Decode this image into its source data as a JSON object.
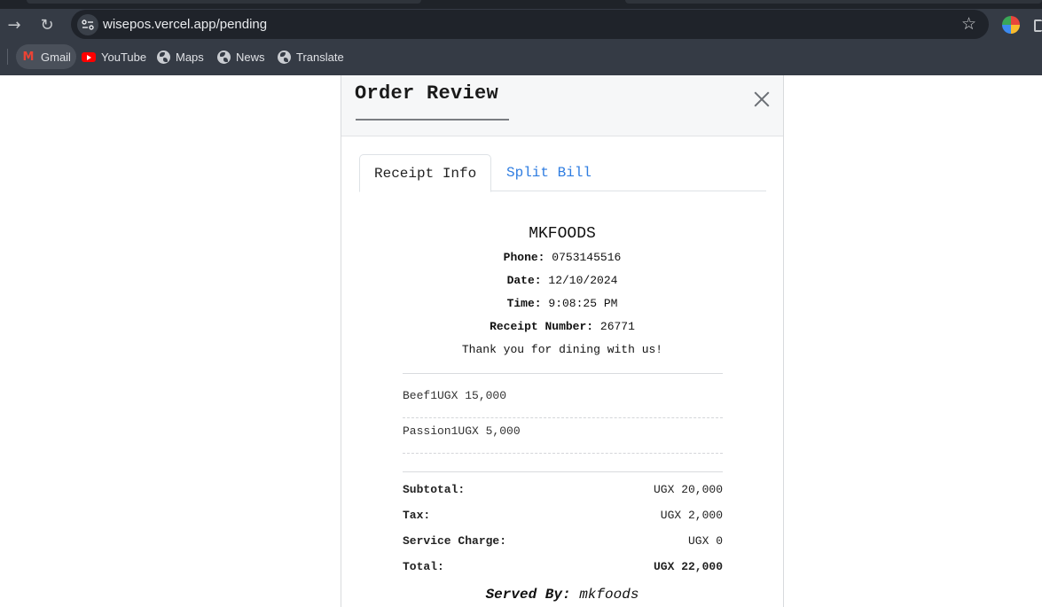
{
  "browser": {
    "url": "wisepos.vercel.app/pending",
    "bookmarks": [
      {
        "label": "Gmail",
        "icon": "gmail-icon"
      },
      {
        "label": "YouTube",
        "icon": "youtube-icon"
      },
      {
        "label": "Maps",
        "icon": "globe-icon"
      },
      {
        "label": "News",
        "icon": "globe-icon"
      },
      {
        "label": "Translate",
        "icon": "globe-icon"
      }
    ]
  },
  "modal": {
    "title": "Order Review",
    "tabs": [
      {
        "label": "Receipt Info",
        "active": true
      },
      {
        "label": "Split Bill",
        "active": false
      }
    ]
  },
  "receipt": {
    "store_name": "MKFOODS",
    "phone_label": "Phone:",
    "phone": "0753145516",
    "date_label": "Date:",
    "date": "12/10/2024",
    "time_label": "Time:",
    "time": "9:08:25 PM",
    "receipt_number_label": "Receipt Number:",
    "receipt_number": "26771",
    "thanks": "Thank you for dining with us!",
    "items": [
      {
        "text": "Beef1UGX 15,000"
      },
      {
        "text": "Passion1UGX 5,000"
      }
    ],
    "subtotal_label": "Subtotal:",
    "subtotal": "UGX 20,000",
    "tax_label": "Tax:",
    "tax": "UGX 2,000",
    "service_label": "Service Charge:",
    "service": "UGX 0",
    "total_label": "Total:",
    "total": "UGX 22,000",
    "served_by_label": "Served By:",
    "served_by": "mkfoods"
  },
  "colors": {
    "link": "#2f7de1",
    "chrome_dark": "#353b45"
  }
}
